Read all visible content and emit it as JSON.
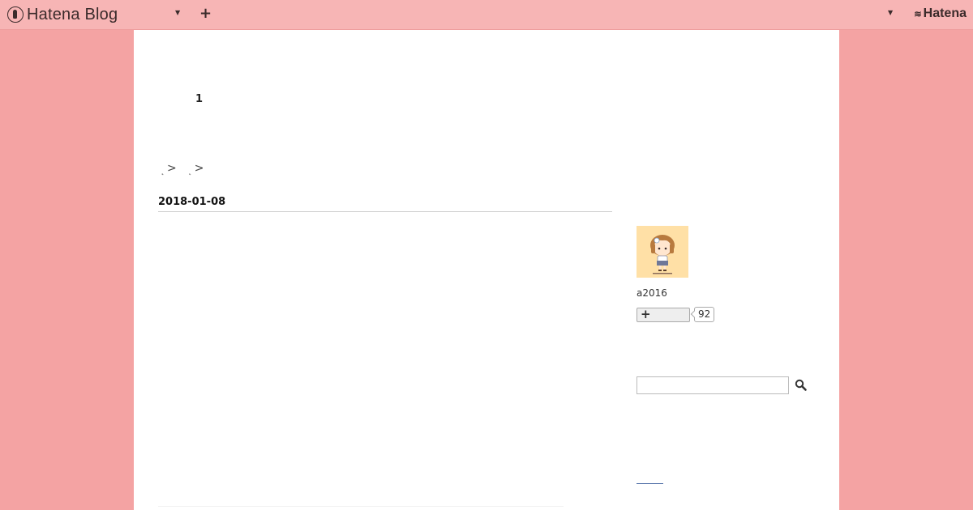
{
  "navbar": {
    "logo_text": "Hatena Blog",
    "add_label": "+",
    "hatena_label": "Hatena"
  },
  "main": {
    "page_number": "1",
    "breadcrumb": [
      {
        "label": "",
        "separator": ">"
      },
      {
        "label": "",
        "separator": ">"
      }
    ],
    "date_heading": "2018-01-08"
  },
  "sidebar": {
    "username": "a2016",
    "subscribe_count": "92",
    "search_placeholder": ""
  },
  "colors": {
    "page_background": "#f4a3a3",
    "navbar_background": "#f7b5b5",
    "content_background": "#ffffff",
    "link": "#3a5d9c"
  },
  "icons": {
    "logo": "hatena-blog-logo-icon",
    "caret": "chevron-down-icon",
    "search": "search-icon"
  }
}
